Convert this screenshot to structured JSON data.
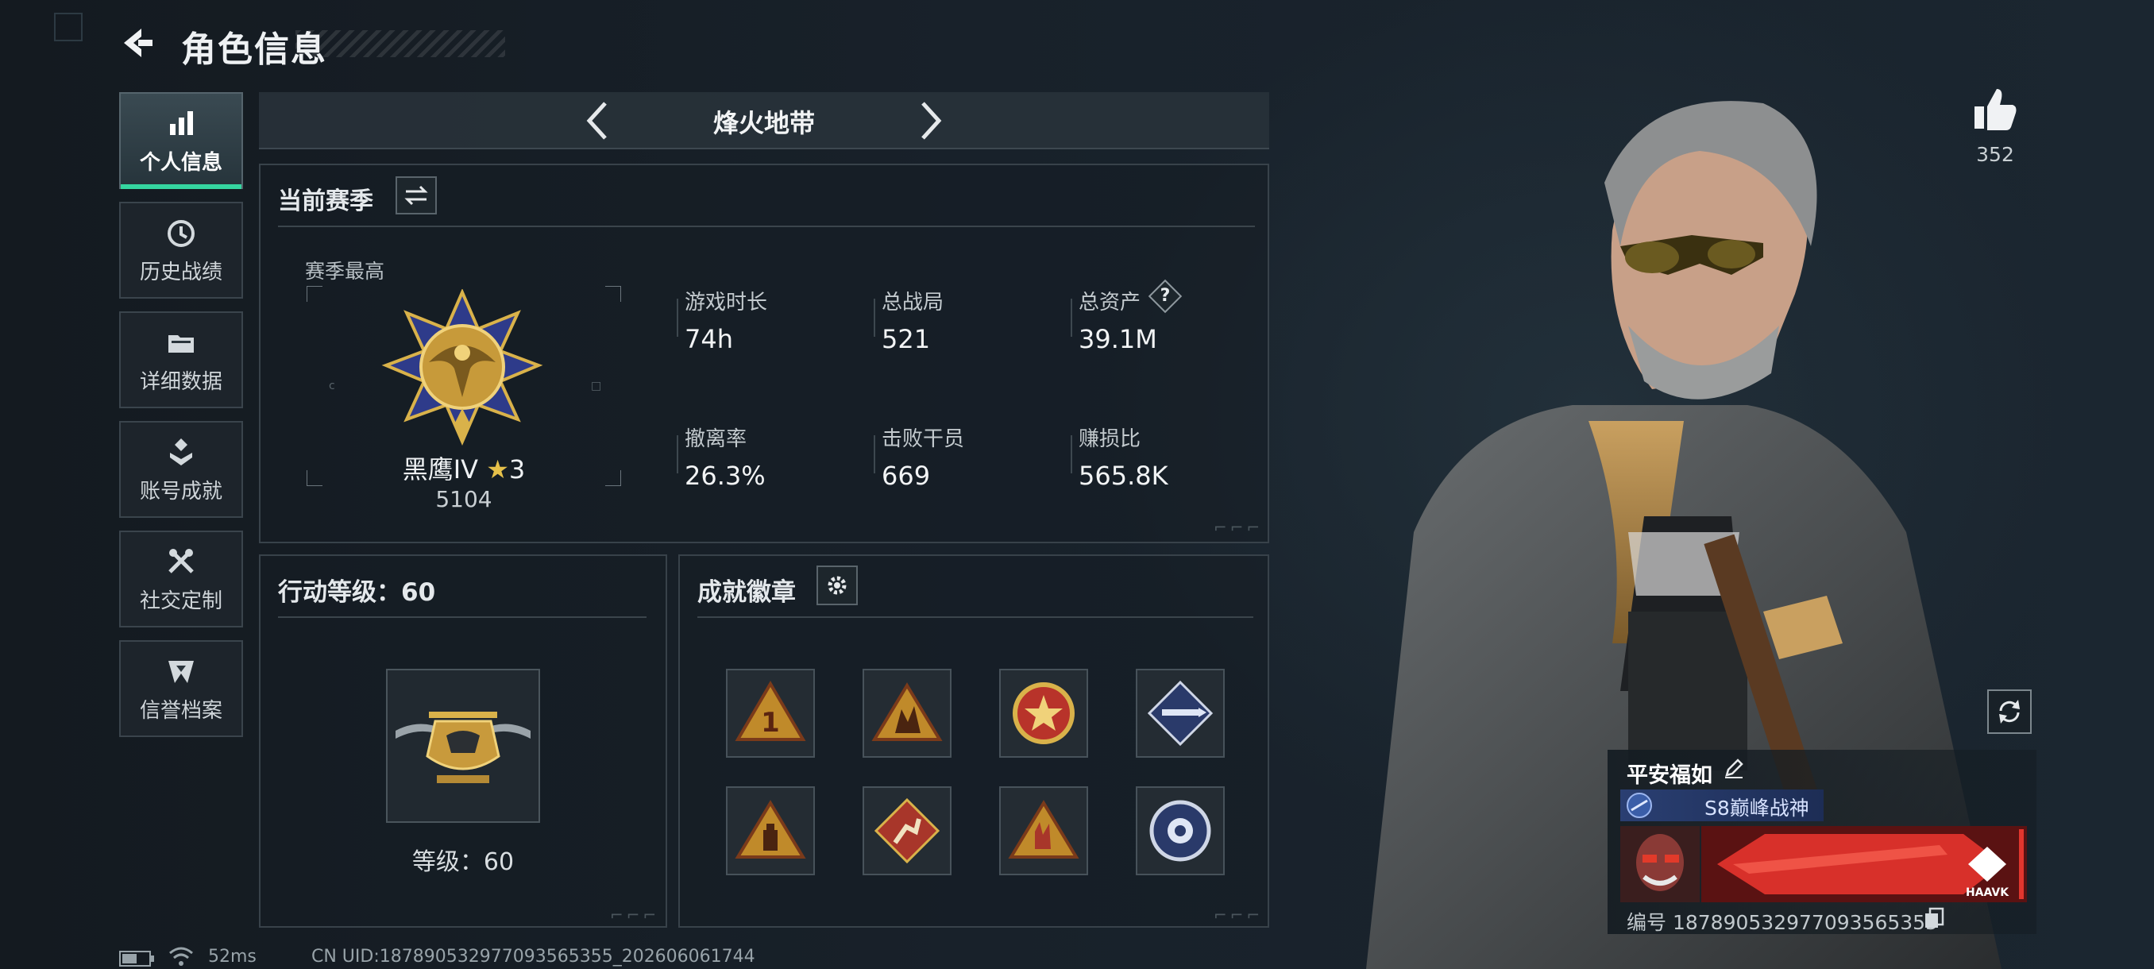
{
  "header": {
    "title": "角色信息"
  },
  "sidebar": {
    "items": [
      {
        "label": "个人信息",
        "icon": "bar-chart-icon",
        "active": true
      },
      {
        "label": "历史战绩",
        "icon": "history-clock-icon"
      },
      {
        "label": "详细数据",
        "icon": "folder-icon"
      },
      {
        "label": "账号成就",
        "icon": "achievement-icon"
      },
      {
        "label": "社交定制",
        "icon": "tools-icon"
      },
      {
        "label": "信誉档案",
        "icon": "credit-shield-icon"
      }
    ]
  },
  "mode": {
    "name": "烽火地带"
  },
  "season": {
    "title": "当前赛季",
    "best_label": "赛季最高",
    "rank_name": "黑鹰IV",
    "rank_stars": "3",
    "rank_score": "5104",
    "stats": [
      {
        "label": "游戏时长",
        "value": "74h"
      },
      {
        "label": "总战局",
        "value": "521"
      },
      {
        "label": "总资产",
        "value": "39.1M",
        "help": "?"
      },
      {
        "label": "撤离率",
        "value": "26.3%"
      },
      {
        "label": "击败干员",
        "value": "669"
      },
      {
        "label": "赚损比",
        "value": "565.8K"
      }
    ]
  },
  "level": {
    "title": "行动等级：60",
    "text": "等级：60"
  },
  "achievements": {
    "title": "成就徽章",
    "badges": [
      "badge-rank-one",
      "badge-squad",
      "badge-star-seal",
      "badge-rocket",
      "badge-supply",
      "badge-runner",
      "badge-hand-sign",
      "badge-flower-seal"
    ]
  },
  "profile": {
    "likes": "352",
    "player_name": "平安福如",
    "title_badge": "S8巅峰战神",
    "player_id": "编号 1878905329770935653​55",
    "nameplate_text": "HAAVK"
  },
  "status": {
    "ping": "52ms",
    "uid": "CN UID:187890532977093565355_202606061744"
  },
  "colors": {
    "accent": "#35d6a0",
    "gold": "#d9b24a",
    "panel_border": "#38424a"
  }
}
